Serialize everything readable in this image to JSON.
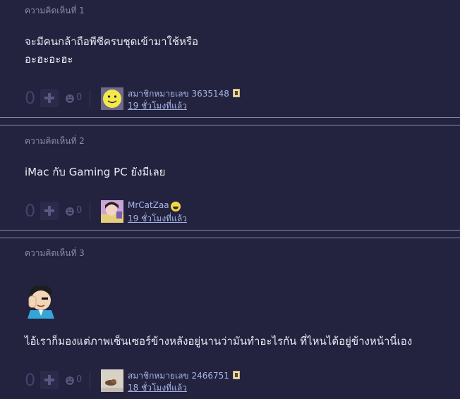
{
  "comments": [
    {
      "number_label": "ความคิดเห็นที่ 1",
      "body_lines": [
        "จะมีคนกล้าถือพีซีครบชุดเข้ามาใช้หรือ",
        "อะฮะอะฮะ"
      ],
      "vote_count": "0",
      "emotion_count": "0",
      "author": "สมาชิกหมายเลข 3635148",
      "time": "19 ชั่วโมงที่แล้ว"
    },
    {
      "number_label": "ความคิดเห็นที่ 2",
      "body_lines": [
        "iMac กับ Gaming PC ยังมีเลย"
      ],
      "vote_count": "0",
      "emotion_count": "0",
      "author": "MrCatZaa",
      "time": "19 ชั่วโมงที่แล้ว"
    },
    {
      "number_label": "ความคิดเห็นที่ 3",
      "body_lines": [
        "ไอ้เราก็มองแต่ภาพเซ็นเซอร์ข้างหลังอยู่นานว่ามันทำอะไรกัน ที่ไหนได้อยู่ข้างหน้านี่เอง"
      ],
      "vote_count": "0",
      "emotion_count": "0",
      "author": "สมาชิกหมายเลข 2466751",
      "time": "18 ชั่วโมงที่แล้ว"
    }
  ],
  "icons": {
    "plus": "plus-icon",
    "emotion": "emotion-face-icon",
    "member_badge": "member-card-icon",
    "smile_badge": "smile-icon"
  },
  "colors": {
    "background": "#23223f",
    "link": "#a7b7e5",
    "muted": "#8d8ba8"
  }
}
